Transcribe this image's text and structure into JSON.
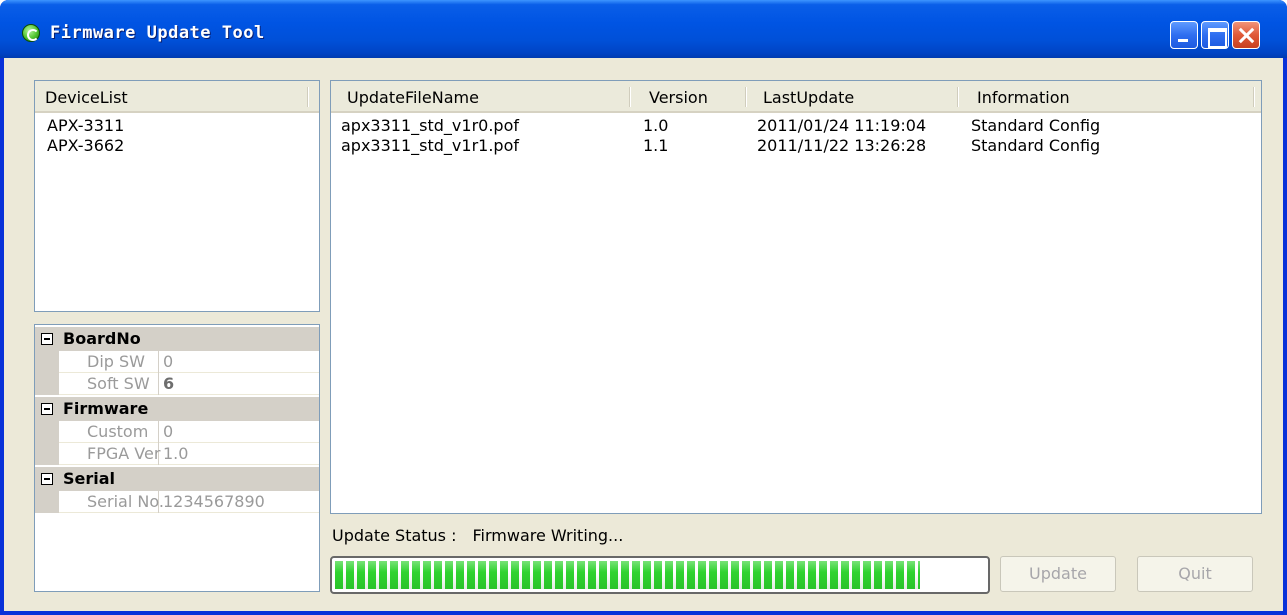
{
  "window": {
    "title": "Firmware Update Tool"
  },
  "device_list": {
    "header": "DeviceList",
    "items": [
      "APX-3311",
      "APX-3662"
    ]
  },
  "properties": {
    "categories": [
      {
        "name": "BoardNo",
        "rows": [
          {
            "name": "Dip SW",
            "value": "0",
            "bold": false
          },
          {
            "name": "Soft SW",
            "value": "6",
            "bold": true
          }
        ]
      },
      {
        "name": "Firmware",
        "rows": [
          {
            "name": "Custom",
            "value": "0",
            "bold": false
          },
          {
            "name": "FPGA Ver",
            "value": "1.0",
            "bold": false
          }
        ]
      },
      {
        "name": "Serial",
        "rows": [
          {
            "name": "Serial No.",
            "value": "1234567890",
            "bold": false
          }
        ]
      }
    ]
  },
  "file_list": {
    "columns": [
      "UpdateFileName",
      "Version",
      "LastUpdate",
      "Information"
    ],
    "rows": [
      [
        "apx3311_std_v1r0.pof",
        "1.0",
        "2011/01/24 11:19:04",
        "Standard Config"
      ],
      [
        "apx3311_std_v1r1.pof",
        "1.1",
        "2011/11/22 13:26:28",
        "Standard Config"
      ]
    ]
  },
  "status": {
    "label": "Update Status :",
    "value": "Firmware Writing..."
  },
  "progress": {
    "fraction": 0.9
  },
  "buttons": {
    "update": "Update",
    "quit": "Quit"
  },
  "colors": {
    "titlebar": "#0054e3",
    "progress_fill": "#2fd32f",
    "client_bg": "#ece9d8"
  }
}
